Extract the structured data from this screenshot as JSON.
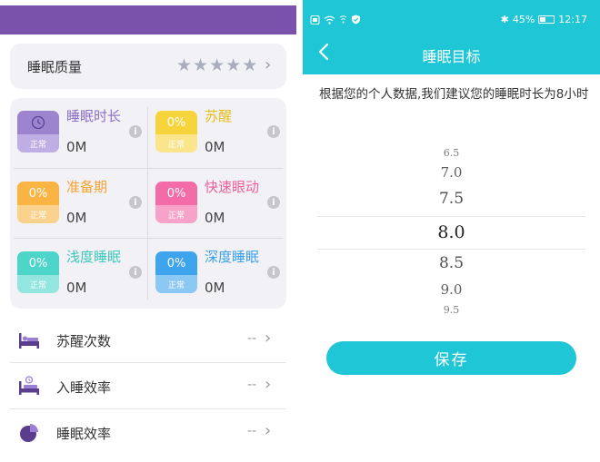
{
  "left": {
    "quality": {
      "label": "睡眠质量",
      "stars_total": 5,
      "stars_filled": 0
    },
    "metrics": [
      {
        "title": "睡眠时长",
        "badge_text": "",
        "badge_status": "正常",
        "value": "0M",
        "icon": "moon-clock-icon",
        "color": "#9d84cf",
        "color_light": "#bfaee4",
        "title_color": "#8a6fc4"
      },
      {
        "title": "苏醒",
        "badge_text": "0%",
        "badge_status": "正常",
        "value": "0M",
        "color": "#f8d43c",
        "color_light": "#fbe58c",
        "title_color": "#e6bf1c"
      },
      {
        "title": "准备期",
        "badge_text": "0%",
        "badge_status": "正常",
        "value": "0M",
        "color": "#f9b444",
        "color_light": "#fbd18e",
        "title_color": "#f2a330"
      },
      {
        "title": "快速眼动",
        "badge_text": "0%",
        "badge_status": "正常",
        "value": "0M",
        "color": "#f36ba7",
        "color_light": "#f7a3c9",
        "title_color": "#ee5f9d"
      },
      {
        "title": "浅度睡眠",
        "badge_text": "0%",
        "badge_status": "正常",
        "value": "0M",
        "color": "#4dd5c9",
        "color_light": "#93e6df",
        "title_color": "#3ec8bb"
      },
      {
        "title": "深度睡眠",
        "badge_text": "0%",
        "badge_status": "正常",
        "value": "0M",
        "color": "#3ea4ee",
        "color_light": "#8cc8f4",
        "title_color": "#3aa0ea"
      }
    ],
    "info_glyph": "i",
    "list": [
      {
        "label": "苏醒次数",
        "value": "--",
        "icon": "bed-icon"
      },
      {
        "label": "入睡效率",
        "value": "--",
        "icon": "bed-clock-icon"
      },
      {
        "label": "睡眠效率",
        "value": "--",
        "icon": "pie-chart-icon"
      }
    ],
    "chevron": "›"
  },
  "right": {
    "status": {
      "battery": "45%",
      "time": "12:17",
      "battery_level": 0.45
    },
    "title": "睡眠目标",
    "recommend_text": "根据您的个人数据,我们建议您的睡眠时长为8小时",
    "picker": {
      "options": [
        "6.5",
        "7.0",
        "7.5",
        "8.0",
        "8.5",
        "9.0",
        "9.5"
      ],
      "selected": "8.0"
    },
    "save_label": "保存"
  },
  "colors": {
    "accent": "#1ec6d6",
    "brand_purple": "#7b52ab"
  }
}
